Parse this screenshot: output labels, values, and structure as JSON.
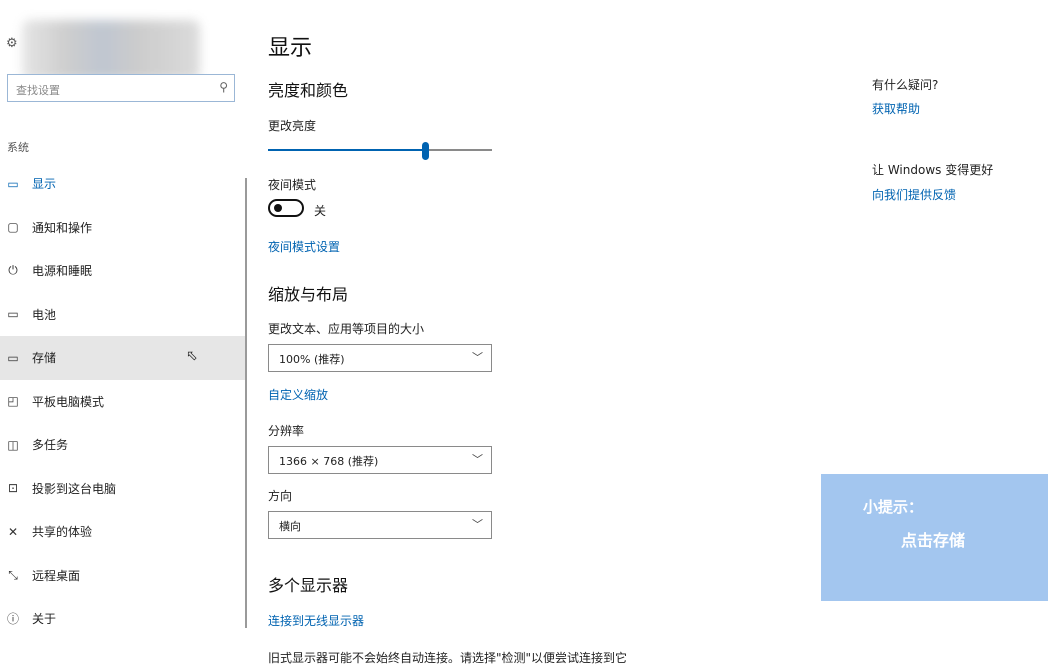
{
  "colors": {
    "accent": "#0063b1",
    "tip_background": "#a3c6ef"
  },
  "sidebar": {
    "search_placeholder": "查找设置",
    "section_label": "系统",
    "items": [
      {
        "label": "显示",
        "icon": "monitor-icon",
        "active": true
      },
      {
        "label": "通知和操作",
        "icon": "notification-icon"
      },
      {
        "label": "电源和睡眠",
        "icon": "power-icon"
      },
      {
        "label": "电池",
        "icon": "battery-icon"
      },
      {
        "label": "存储",
        "icon": "storage-icon",
        "hovered": true
      },
      {
        "label": "平板电脑模式",
        "icon": "tablet-mode-icon"
      },
      {
        "label": "多任务",
        "icon": "multitasking-icon"
      },
      {
        "label": "投影到这台电脑",
        "icon": "projecting-icon"
      },
      {
        "label": "共享的体验",
        "icon": "shared-experiences-icon"
      },
      {
        "label": "远程桌面",
        "icon": "remote-desktop-icon"
      },
      {
        "label": "关于",
        "icon": "info-icon"
      }
    ]
  },
  "main": {
    "title": "显示",
    "brightness_section": "亮度和颜色",
    "brightness_label": "更改亮度",
    "brightness_value": 0.7,
    "night_mode_label": "夜间模式",
    "night_mode_state": "关",
    "night_mode_settings_link": "夜间模式设置",
    "scale_section": "缩放与布局",
    "scale_label": "更改文本、应用等项目的大小",
    "scale_value": "100% (推荐)",
    "custom_scale_link": "自定义缩放",
    "resolution_label": "分辨率",
    "resolution_value": "1366 × 768 (推荐)",
    "orientation_label": "方向",
    "orientation_value": "横向",
    "multi_display_section": "多个显示器",
    "wireless_display_link": "连接到无线显示器",
    "legacy_note": "旧式显示器可能不会始终自动连接。请选择\"检测\"以便尝试连接到它"
  },
  "right_panel": {
    "question": "有什么疑问?",
    "help_link": "获取帮助",
    "improve_text": "让 Windows 变得更好",
    "feedback_link": "向我们提供反馈"
  },
  "tip": {
    "title": "小提示：",
    "body": "点击存储"
  }
}
